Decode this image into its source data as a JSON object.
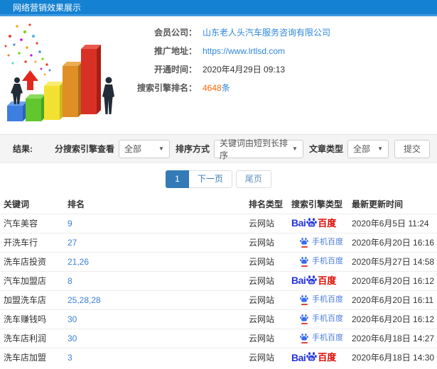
{
  "header": {
    "title": "网络营销效果展示"
  },
  "member": {
    "company_label": "会员公司：",
    "company": "山东老人头汽车服务咨询有限公司",
    "url_label": "推广地址：",
    "url": "https://www.lrtlsd.com",
    "opened_label": "开通时间：",
    "opened": "2020年4月29日 09:13",
    "ranking_label": "搜索引擎排名：",
    "ranking_count": "4648",
    "ranking_unit": "条"
  },
  "filter": {
    "result_label": "结果:",
    "engine_label": "分搜索引擎查看",
    "engine_selected": "全部",
    "sort_label": "排序方式",
    "sort_selected": "关键词由短到长排序",
    "article_label": "文章类型",
    "article_selected": "全部",
    "submit": "提交"
  },
  "pagination": {
    "page1": "1",
    "next": "下一页",
    "last": "尾页"
  },
  "table": {
    "headers": [
      "关键词",
      "排名",
      "排名类型",
      "搜索引擎类型",
      "最新更新时间"
    ],
    "rows": [
      {
        "keyword": "汽车美容",
        "rank": "9",
        "rank_type": "云网站",
        "engine": "baidu-pc",
        "updated": "2020年6月5日 11:24"
      },
      {
        "keyword": "开洗车行",
        "rank": "27",
        "rank_type": "云网站",
        "engine": "baidu-mobile",
        "updated": "2020年6月20日 16:16"
      },
      {
        "keyword": "洗车店投资",
        "rank": "21,26",
        "rank_type": "云网站",
        "engine": "baidu-mobile",
        "updated": "2020年5月27日 14:58"
      },
      {
        "keyword": "汽车加盟店",
        "rank": "8",
        "rank_type": "云网站",
        "engine": "baidu-pc",
        "updated": "2020年6月20日 16:12"
      },
      {
        "keyword": "加盟洗车店",
        "rank": "25,28,28",
        "rank_type": "云网站",
        "engine": "baidu-mobile",
        "updated": "2020年6月20日 16:11"
      },
      {
        "keyword": "洗车赚钱吗",
        "rank": "30",
        "rank_type": "云网站",
        "engine": "baidu-mobile",
        "updated": "2020年6月20日 16:12"
      },
      {
        "keyword": "洗车店利润",
        "rank": "30",
        "rank_type": "云网站",
        "engine": "baidu-mobile",
        "updated": "2020年6月18日 14:27"
      },
      {
        "keyword": "洗车店加盟",
        "rank": "3",
        "rank_type": "云网站",
        "engine": "baidu-pc",
        "updated": "2020年6月18日 14:30"
      }
    ]
  },
  "engines": {
    "baidu_pc": {
      "bai": "Bai",
      "du": "du",
      "cn": "百度"
    },
    "baidu_mobile": {
      "label": "手机百度"
    }
  },
  "colors": {
    "header_bg": "#1581d2",
    "link_blue": "#2c87dd",
    "rank_blue": "#3a7fd5",
    "highlight_orange": "#ff6600",
    "pagination_active": "#337ab7",
    "baidu_blue": "#2534dc",
    "baidu_red": "#dd0a01",
    "mobile_blue": "#4a7cdb",
    "filter_bg": "#f4f4f4"
  }
}
